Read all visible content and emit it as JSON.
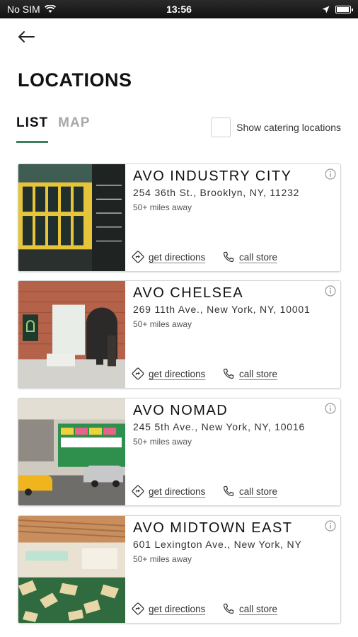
{
  "status_bar": {
    "carrier": "No SIM",
    "time": "13:56"
  },
  "header": {
    "title": "LOCATIONS"
  },
  "tabs": [
    {
      "label": "LIST",
      "active": true
    },
    {
      "label": "MAP",
      "active": false
    }
  ],
  "filter": {
    "catering_label": "Show catering locations",
    "checked": false
  },
  "locations": [
    {
      "name": "AVO INDUSTRY CITY",
      "address": "254 36th St., Brooklyn, NY, 11232",
      "distance": "50+ miles away",
      "directions_label": "get directions",
      "call_label": "call store"
    },
    {
      "name": "AVO CHELSEA",
      "address": "269 11th Ave., New York, NY, 10001",
      "distance": "50+ miles away",
      "directions_label": "get directions",
      "call_label": "call store"
    },
    {
      "name": "AVO NOMAD",
      "address": "245 5th Ave., New York, NY, 10016",
      "distance": "50+ miles away",
      "directions_label": "get directions",
      "call_label": "call store"
    },
    {
      "name": "AVO MIDTOWN EAST",
      "address": "601 Lexington Ave., New York, NY",
      "distance": "50+ miles away",
      "directions_label": "get directions",
      "call_label": "call store"
    }
  ],
  "colors": {
    "accent": "#3f7d5f",
    "inactive_tab": "#a8a8a8",
    "card_border": "#d6d6d6"
  },
  "icons": [
    "back-arrow-icon",
    "info-icon",
    "directions-icon",
    "phone-icon",
    "wifi-icon",
    "location-arrow-icon",
    "battery-icon"
  ]
}
